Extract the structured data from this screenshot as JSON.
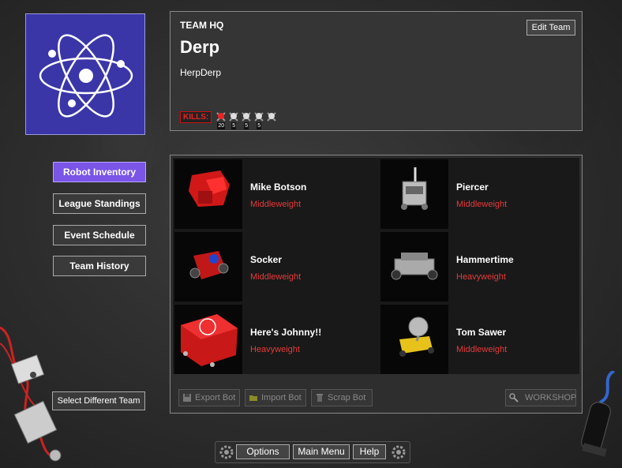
{
  "team": {
    "hq_label": "TEAM HQ",
    "name": "Derp",
    "subtitle": "HerpDerp",
    "edit_label": "Edit Team",
    "kills_label": "KILLS:",
    "kill_counts": [
      "20",
      "5",
      "5",
      "5",
      ""
    ]
  },
  "nav": {
    "robot_inventory": "Robot Inventory",
    "league_standings": "League Standings",
    "event_schedule": "Event Schedule",
    "team_history": "Team History",
    "select_team": "Select Different Team"
  },
  "robots": [
    {
      "name": "Mike Botson",
      "class": "Middleweight"
    },
    {
      "name": "Piercer",
      "class": "Middleweight"
    },
    {
      "name": "Socker",
      "class": "Middleweight"
    },
    {
      "name": "Hammertime",
      "class": "Heavyweight"
    },
    {
      "name": "Here's Johnny!!",
      "class": "Heavyweight"
    },
    {
      "name": "Tom Sawer",
      "class": "Middleweight"
    }
  ],
  "toolbar": {
    "export": "Export Bot",
    "import": "Import Bot",
    "scrap": "Scrap Bot",
    "workshop": "WORKSHOP"
  },
  "bottom": {
    "options": "Options",
    "main_menu": "Main Menu",
    "help": "Help"
  },
  "colors": {
    "logo_bg": "#3a36a8",
    "active_nav": "#7a55e8",
    "weight_class": "#e63a3a"
  }
}
